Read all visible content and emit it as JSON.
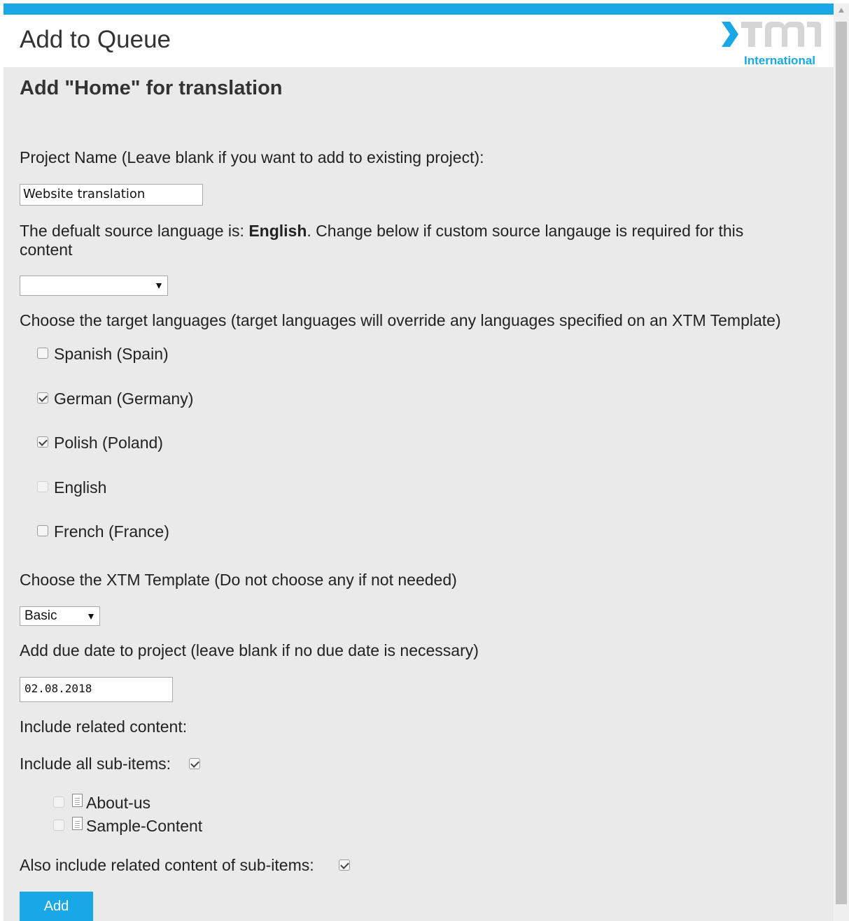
{
  "header": {
    "title": "Add to Queue",
    "logo_text": "XTM",
    "logo_sub": "International",
    "brand_color": "#18a8e6"
  },
  "form": {
    "heading": "Add \"Home\" for translation",
    "project_name_label": "Project Name (Leave blank if you want to add to existing project):",
    "project_name_value": "Website translation",
    "source_lang_prefix": "The defualt source language is: ",
    "source_lang_value": "English",
    "source_lang_suffix": ". Change below if custom source langauge is required for this",
    "source_lang_suffix2": "content",
    "source_select_value": "",
    "target_langs_label": "Choose the target languages (target languages will override any languages specified on an XTM Template)",
    "target_languages": [
      {
        "label": "Spanish (Spain)",
        "checked": false,
        "disabled": false
      },
      {
        "label": "German (Germany)",
        "checked": true,
        "disabled": false
      },
      {
        "label": "Polish (Poland)",
        "checked": true,
        "disabled": false
      },
      {
        "label": "English",
        "checked": false,
        "disabled": true
      },
      {
        "label": "French (France)",
        "checked": false,
        "disabled": false
      }
    ],
    "template_label": "Choose the XTM Template (Do not choose any if not needed)",
    "template_value": "Basic",
    "due_date_label": "Add due date to project (leave blank if no due date is necessary)",
    "due_date_value": "02.08.2018",
    "related_label": "Include related content:",
    "subitems_label": "Include all sub-items:",
    "subitems": [
      {
        "label": "About-us",
        "checked": false
      },
      {
        "label": "Sample-Content",
        "checked": false
      }
    ],
    "also_include_label": "Also include related content of sub-items:",
    "add_button": "Add"
  }
}
